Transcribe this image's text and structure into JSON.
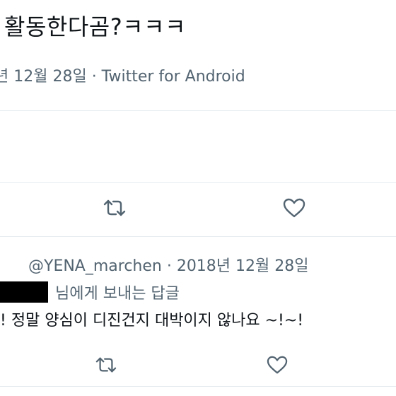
{
  "tweet": {
    "text": "활동한다곰?ㅋㅋㅋ",
    "meta": "년 12월 28일 · Twitter for Android"
  },
  "reply": {
    "header": "@YENA_marchen · 2018년 12월 28일",
    "replying_to": "님에게 보내는 답글",
    "text": "! 정말 양심이 디진건지 대박이지 않나요 ~!~!"
  },
  "icons": {
    "retweet": "retweet-icon",
    "like": "heart-icon"
  },
  "colors": {
    "text": "#0f1419",
    "secondary": "#536471",
    "divider": "#e6ecf0",
    "icon": "#536471"
  }
}
